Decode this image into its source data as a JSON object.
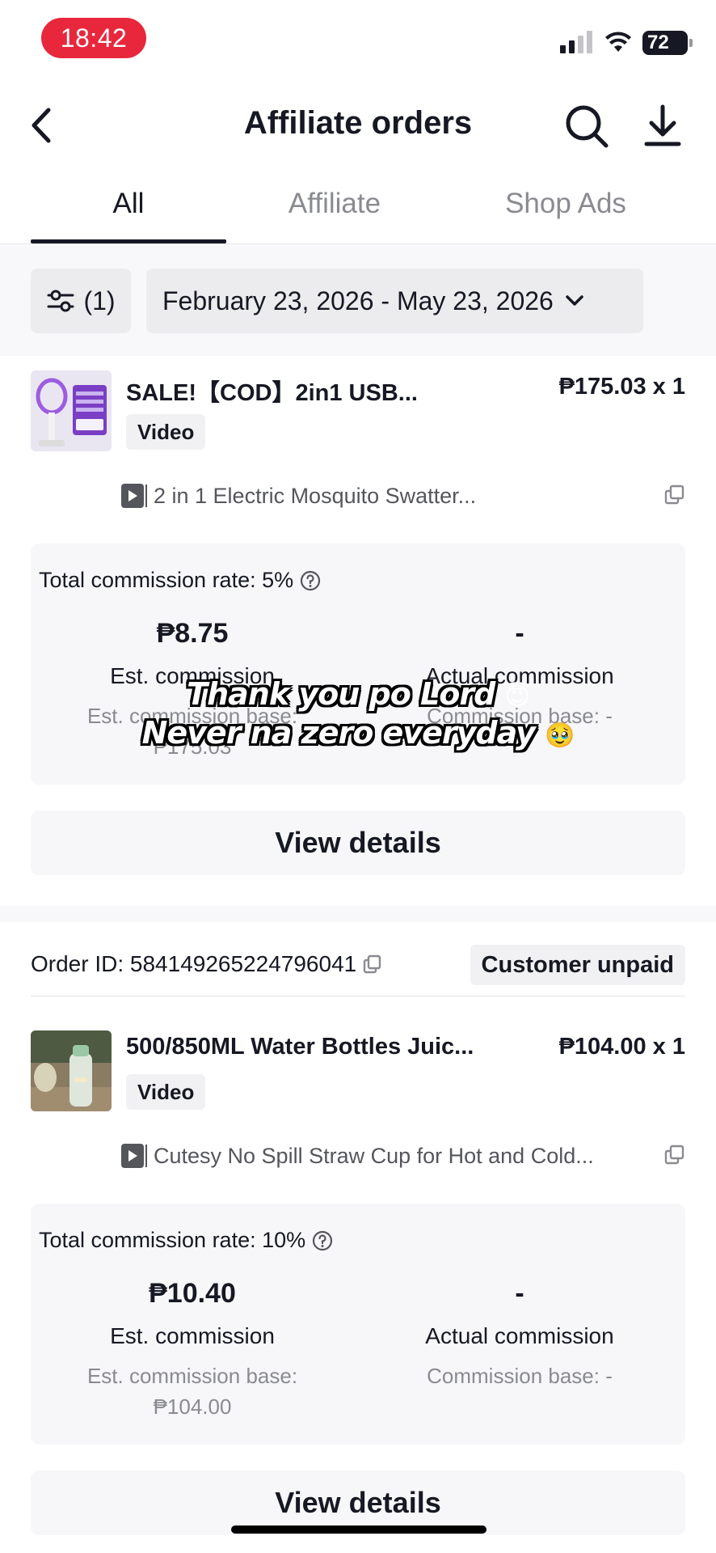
{
  "status_bar": {
    "time": "18:42",
    "battery": "72"
  },
  "header": {
    "title": "Affiliate orders",
    "back_icon": "chevron-left-icon",
    "search_icon": "search-icon",
    "download_icon": "download-icon"
  },
  "tabs": [
    {
      "label": "All",
      "active": true
    },
    {
      "label": "Affiliate",
      "active": false
    },
    {
      "label": "Shop Ads",
      "active": false
    }
  ],
  "filters": {
    "filter_count": "(1)",
    "date_range": "February 23, 2026 - May 23, 2026"
  },
  "orders": [
    {
      "product_name": "SALE!【COD】2in1 USB...",
      "price": "₱175.03 x 1",
      "content_badge": "Video",
      "video_title": "2 in 1 Electric Mosquito Swatter...",
      "commission_rate": "Total commission rate: 5%",
      "est_amount": "₱8.75",
      "est_label": "Est. commission",
      "est_base_label": "Est. commission base:",
      "est_base_value": "₱175.03",
      "actual_amount": "-",
      "actual_label": "Actual commission",
      "actual_base": "Commission base: -",
      "details_label": "View details"
    },
    {
      "order_id": "Order ID: 584149265224796041",
      "status": "Customer unpaid",
      "product_name": "500/850ML Water Bottles Juic...",
      "price": "₱104.00 x 1",
      "content_badge": "Video",
      "video_title": "Cutesy No Spill Straw Cup for Hot and Cold...",
      "commission_rate": "Total commission rate: 10%",
      "est_amount": "₱10.40",
      "est_label": "Est. commission",
      "est_base_label": "Est. commission base:",
      "est_base_value": "₱104.00",
      "actual_amount": "-",
      "actual_label": "Actual commission",
      "actual_base": "Commission base: -",
      "details_label": "View details"
    }
  ],
  "overlay_caption": {
    "line1": "Thank you po Lord",
    "line1_emoji": "😇",
    "line2": "Never na zero everyday",
    "line2_emoji": "🥹"
  }
}
